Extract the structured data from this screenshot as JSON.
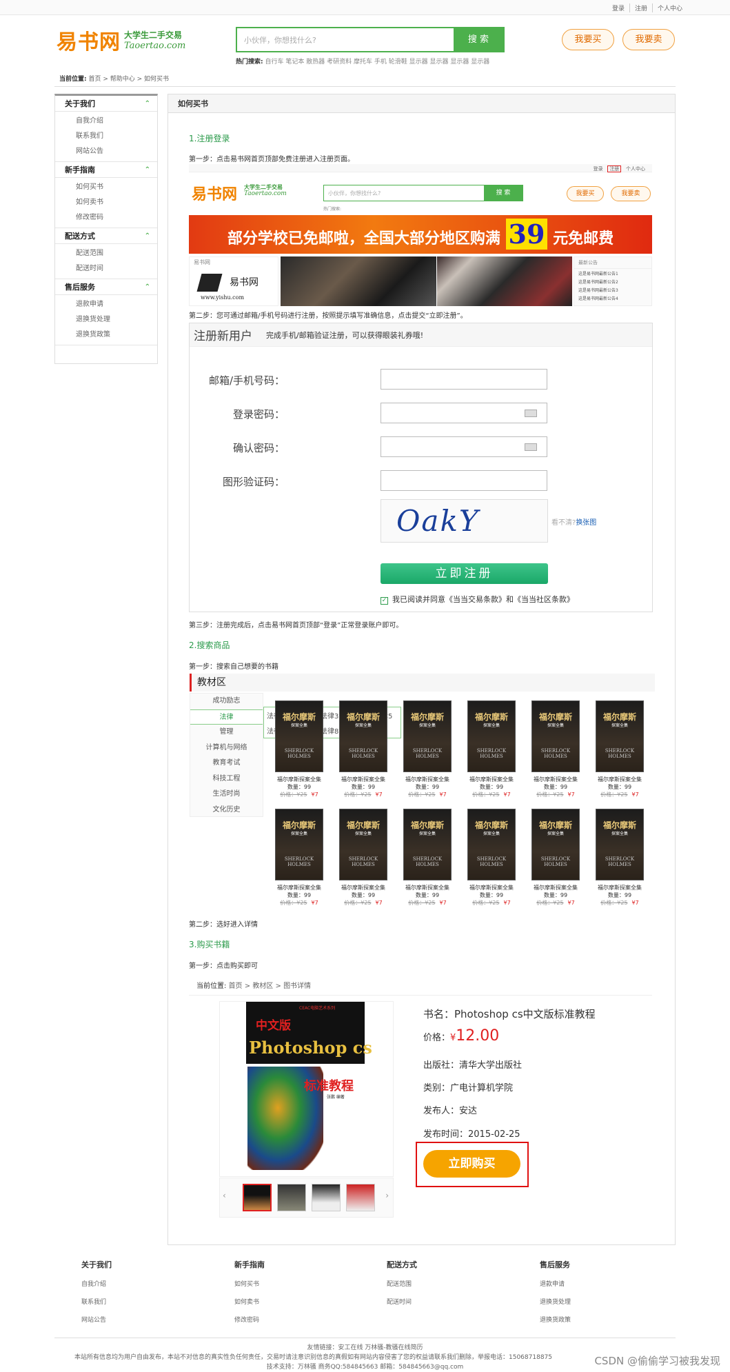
{
  "topbar": {
    "login": "登录",
    "register": "注册",
    "personal": "个人中心"
  },
  "logo": {
    "main": "易书网",
    "sub1": "大学生二手交易",
    "sub2": "Taoertao.com"
  },
  "search": {
    "placeholder": "小伙伴，你想找什么?",
    "button": "搜 索"
  },
  "hot": {
    "label": "热门搜索:",
    "items": [
      "自行车",
      "笔记本",
      "散热器",
      "考研资料",
      "摩托车",
      "手机",
      "轮滑鞋",
      "显示器",
      "显示器",
      "显示器",
      "显示器"
    ]
  },
  "actions": {
    "buy": "我要买",
    "sell": "我要卖"
  },
  "breadcrumb": {
    "label": "当前位置:",
    "path": [
      "首页",
      "帮助中心",
      "如何买书"
    ],
    "sep": ">"
  },
  "sidebar": [
    {
      "title": "关于我们",
      "items": [
        "自我介绍",
        "联系我们",
        "网站公告"
      ]
    },
    {
      "title": "新手指南",
      "items": [
        "如何买书",
        "如何卖书",
        "修改密码"
      ]
    },
    {
      "title": "配送方式",
      "items": [
        "配送范围",
        "配送时间"
      ]
    },
    {
      "title": "售后服务",
      "items": [
        "退款申请",
        "退换货处理",
        "退换货政策"
      ]
    }
  ],
  "content": {
    "title": "如何买书",
    "s1": "1.注册登录",
    "s1_step1": "第一步：点击易书网首页顶部免费注册进入注册页面。",
    "banner_text": "部分学校已免邮啦，全国大部分地区购满",
    "banner_num": "39",
    "banner_tail": "元免邮费",
    "mini_site": "易书网",
    "mini_logo": "易书网",
    "mini_url": "www.yishu.com",
    "mini_notice_title": "最新公告",
    "mini_notices": [
      "这是易书网最新公告1",
      "这是易书网最新公告2",
      "这是易书网最新公告3",
      "这是易书网最新公告4"
    ],
    "s1_step2": "第二步：您可通过邮箱/手机号码进行注册，按照提示填写准确信息，点击提交“立即注册”。",
    "reg_title": "注册新用户",
    "reg_sub": "完成手机/邮箱验证注册，可以获得眼装礼券哦!",
    "reg_fields": [
      "邮箱/手机号码：",
      "登录密码：",
      "确认密码：",
      "图形验证码："
    ],
    "captcha": "OakY",
    "captcha_hint": "看不清?",
    "captcha_change": "换张图",
    "reg_button": "立即注册",
    "agree": "我已阅读并同意《当当交易条款》和《当当社区条款》",
    "s1_step3": "第三步：注册完成后，点击易书网首页顶部“登录”正常登录账户即可。",
    "s2": "2.搜索商品",
    "s2_step1": "第一步：搜索自己想要的书籍",
    "cat_title": "教材区",
    "categories": [
      "成功励志",
      "法律",
      "管理",
      "计算机与网络",
      "教育考试",
      "科技工程",
      "生活时尚",
      "文化历史"
    ],
    "subcats": [
      "法律1",
      "法律2",
      "法律3",
      "法律4",
      "法律5",
      "法律6",
      "法律7",
      "法律8",
      "法律9"
    ],
    "book": {
      "cover_title": "福尔摩斯",
      "cover_sub": "探案全集",
      "cover_en": "SHERLOCK HOLMES",
      "name": "福尔摩斯探案全集",
      "qty": "数量：99",
      "old": "价格：¥25",
      "price": "¥7"
    },
    "s2_step2": "第二步：选好进入详情",
    "s3": "3.购买书籍",
    "s3_step1": "第一步：点击购买即可",
    "detail_crumb": {
      "label": "当前位置:",
      "path": [
        "首页",
        "教材区",
        "图书详情"
      ]
    },
    "cover": {
      "series": "CEAC电脑艺术系列",
      "cn": "中文版",
      "ps": "Photoshop cs",
      "std": "标准教程",
      "author": "张鹏  编著"
    },
    "info": {
      "name": "书名：Photoshop cs中文版标准教程",
      "price_label": "价格：",
      "currency": "¥",
      "price": "12.00",
      "publisher": "出版社：清华大学出版社",
      "category": "类别：广电计算机学院",
      "seller": "发布人：安达",
      "time": "发布时间：2015-02-25"
    },
    "buy_button": "立即购买"
  },
  "footer": {
    "cols": [
      {
        "title": "关于我们",
        "items": [
          "自我介绍",
          "联系我们",
          "网站公告"
        ]
      },
      {
        "title": "新手指南",
        "items": [
          "如何买书",
          "如何卖书",
          "修改密码"
        ]
      },
      {
        "title": "配送方式",
        "items": [
          "配送范围",
          "配送时间"
        ]
      },
      {
        "title": "售后服务",
        "items": [
          "退款申请",
          "退换货处理",
          "退换货政策"
        ]
      }
    ],
    "links": "友情链接：安工在线  万林骚-教骚在线简历",
    "notice": "本站所有信息均为用户自由发布，本站不对信息的真实性负任何责任，交易时请注意识别信息的真假如有网站内容侵害了您的权益请联系我们删除，举报电话：15068718875",
    "support": "技术支持：万林骚  商务QQ:584845663  邮箱：584845663@qq.com",
    "watermark": "CSDN @偷偷学习被我发现"
  }
}
